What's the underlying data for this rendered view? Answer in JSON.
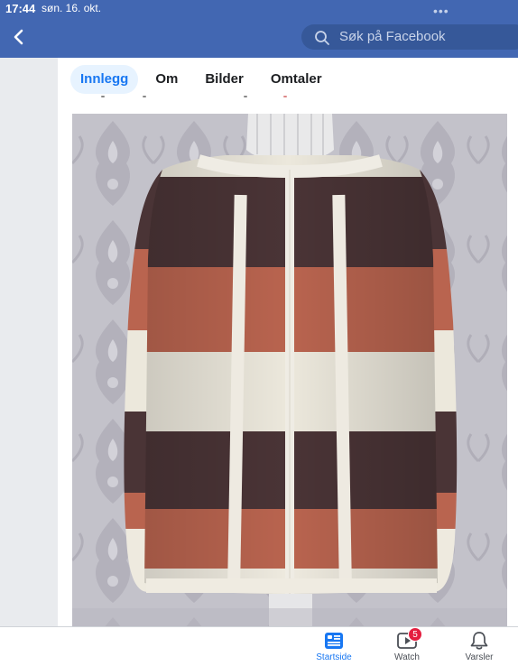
{
  "status": {
    "time": "17:44",
    "date": "søn. 16. okt."
  },
  "header": {
    "search_placeholder": "Søk på Facebook"
  },
  "tabs": [
    {
      "label": "Innlegg",
      "active": true
    },
    {
      "label": "Om",
      "active": false
    },
    {
      "label": "Bilder",
      "active": false
    },
    {
      "label": "Omtaler",
      "active": false
    }
  ],
  "bottom_nav": [
    {
      "label": "Startside",
      "icon": "home-feed-icon",
      "active": true
    },
    {
      "label": "Watch",
      "icon": "watch-video-icon",
      "badge": "5",
      "active": false
    },
    {
      "label": "Varsler",
      "icon": "bell-icon",
      "active": false
    }
  ],
  "colors": {
    "brand": "#4267b2",
    "accent": "#1877f2",
    "badge": "#e41e3f"
  }
}
